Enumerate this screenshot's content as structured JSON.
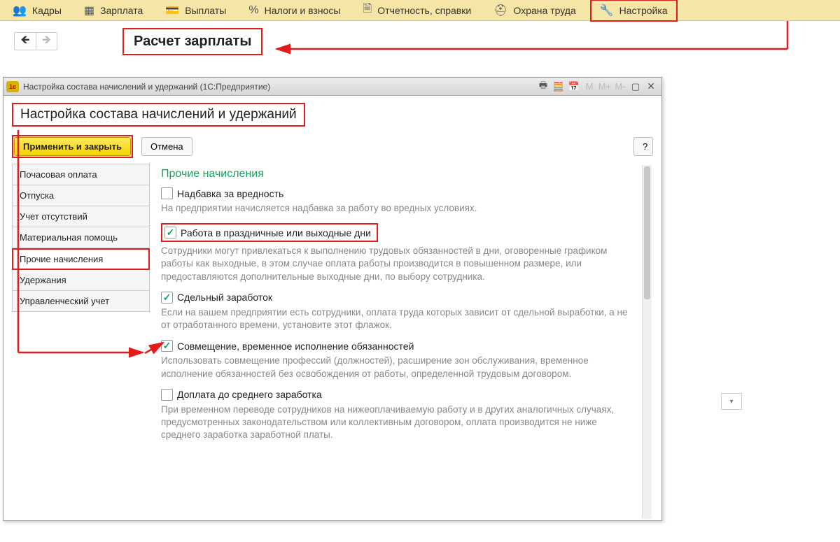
{
  "topnav": [
    {
      "icon": "👥",
      "label": "Кадры"
    },
    {
      "icon": "▦",
      "label": "Зарплата"
    },
    {
      "icon": "💳",
      "label": "Выплаты"
    },
    {
      "icon": "%",
      "label": "Налоги и взносы"
    },
    {
      "icon": "🗎",
      "label": "Отчетность, справки"
    },
    {
      "icon": "⛑",
      "label": "Охрана труда"
    },
    {
      "icon": "🔧",
      "label": "Настройка"
    }
  ],
  "calc_heading": "Расчет зарплаты",
  "window": {
    "title": "Настройка состава начислений и удержаний  (1С:Предприятие)",
    "app_badge": "1c",
    "mem_buttons": [
      "M",
      "M+",
      "M-"
    ]
  },
  "form_title": "Настройка состава начислений и удержаний",
  "buttons": {
    "apply": "Применить и закрыть",
    "cancel": "Отмена",
    "help": "?"
  },
  "tabs": [
    "Почасовая оплата",
    "Отпуска",
    "Учет отсутствий",
    "Материальная помощь",
    "Прочие начисления",
    "Удержания",
    "Управленческий учет"
  ],
  "panel_title": "Прочие начисления",
  "options": [
    {
      "checked": false,
      "label": "Надбавка за вредность",
      "desc": "На предприятии начисляется надбавка за работу во вредных условиях.",
      "highlight": false
    },
    {
      "checked": true,
      "label": "Работа в праздничные или выходные дни",
      "desc": "Сотрудники могут привлекаться к выполнению трудовых обязанностей в дни, оговоренные графиком работы как выходные, в этом случае оплата работы производится в повышенном размере, или предоставляются дополнительные выходные дни, по выбору сотрудника.",
      "highlight": true
    },
    {
      "checked": true,
      "label": "Сдельный заработок",
      "desc": "Если на вашем предприятии есть сотрудники, оплата труда которых зависит от сдельной выработки, а не от отработанного времени, установите этот флажок.",
      "highlight": false
    },
    {
      "checked": true,
      "label": "Совмещение, временное исполнение обязанностей",
      "desc": "Использовать совмещение профессий (должностей), расширение зон обслуживания, временное исполнение обязанностей без освобождения от работы, определенной трудовым договором.",
      "highlight": false
    },
    {
      "checked": false,
      "label": "Доплата до среднего заработка",
      "desc": "При временном переводе сотрудников на нижеоплачиваемую работу и в других аналогичных случаях, предусмотренных законодательством или коллективным договором, оплата производится не ниже среднего заработка заработной платы.",
      "highlight": false
    }
  ]
}
